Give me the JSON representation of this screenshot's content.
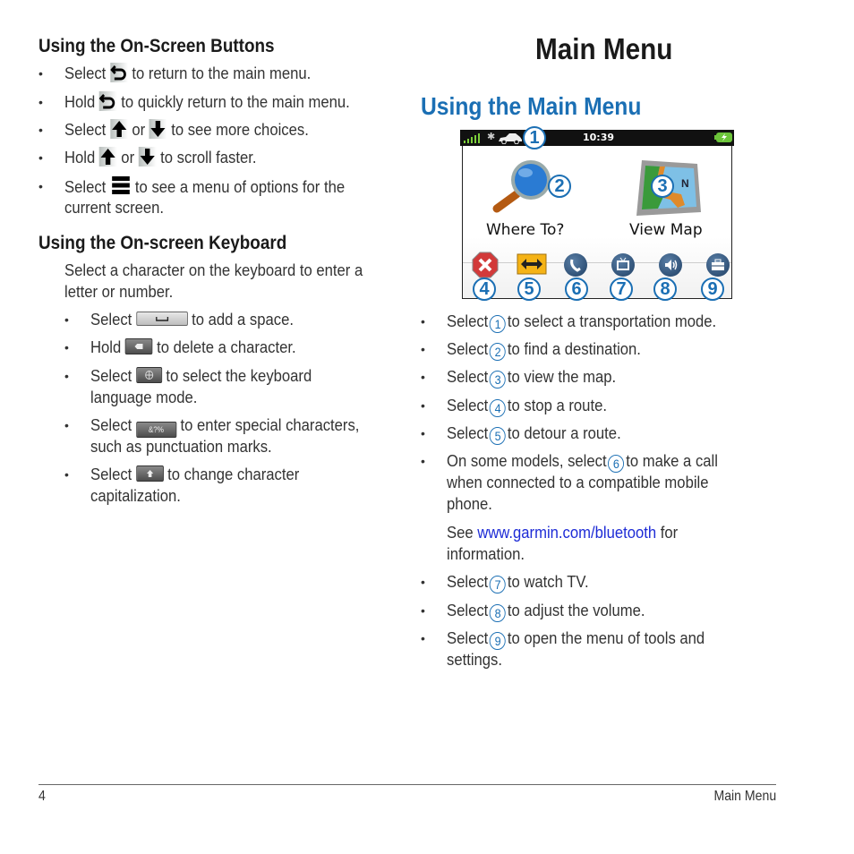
{
  "left": {
    "section1": {
      "title": "Using the On-Screen Buttons",
      "items": [
        {
          "prefix": "Select",
          "icon": "back-arrow-icon",
          "suffix": "to return to the main menu."
        },
        {
          "prefix": "Hold",
          "icon": "back-arrow-icon",
          "suffix": "to quickly return to the main menu."
        },
        {
          "prefix": "Select",
          "icon": "up-arrow-icon",
          "mid": "or",
          "icon2": "down-arrow-icon",
          "suffix": "to see more choices."
        },
        {
          "prefix": "Hold",
          "icon": "up-arrow-icon",
          "mid": "or",
          "icon2": "down-arrow-icon",
          "suffix": "to scroll faster."
        },
        {
          "prefix": "Select",
          "icon": "menu-icon",
          "suffix": "to see a menu of options for the",
          "line2": "current screen."
        }
      ]
    },
    "section2": {
      "title": "Using the On-screen Keyboard",
      "intro_line1": "Select a character on the keyboard to enter a",
      "intro_line2": "letter or number.",
      "items": [
        {
          "prefix": "Select",
          "icon": "space-key-icon",
          "suffix": "to add a space."
        },
        {
          "prefix": "Hold",
          "icon": "delete-key-icon",
          "suffix": "to delete a character."
        },
        {
          "prefix": "Select",
          "icon": "language-key-icon",
          "suffix": "to select the keyboard",
          "line2": "language mode."
        },
        {
          "prefix": "Select",
          "icon": "special-chars-key-icon",
          "key_label": "&?%",
          "suffix": "to enter special characters,",
          "line2": "such as punctuation marks."
        },
        {
          "prefix": "Select",
          "icon": "shift-key-icon",
          "suffix": "to change character",
          "line2": "capitalization."
        }
      ]
    }
  },
  "right": {
    "page_title": "Main Menu",
    "section_title": "Using the Main Menu",
    "device": {
      "time": "10:39",
      "where_to": "Where To?",
      "view_map": "View Map",
      "callouts": [
        "1",
        "2",
        "3",
        "4",
        "5",
        "6",
        "7",
        "8",
        "9"
      ]
    },
    "items": [
      {
        "prefix": "Select",
        "num": "1",
        "suffix": "to select a transportation mode."
      },
      {
        "prefix": "Select",
        "num": "2",
        "suffix": "to find a destination."
      },
      {
        "prefix": "Select",
        "num": "3",
        "suffix": "to view the map."
      },
      {
        "prefix": "Select",
        "num": "4",
        "suffix": "to stop a route."
      },
      {
        "prefix": "Select",
        "num": "5",
        "suffix": "to detour a route."
      },
      {
        "prefix": "On some models, select",
        "num": "6",
        "suffix": "to make a call",
        "line2": "when connected to a compatible mobile",
        "line3": "phone."
      },
      {
        "prefix": "Select",
        "num": "7",
        "suffix": "to watch TV."
      },
      {
        "prefix": "Select",
        "num": "8",
        "suffix": "to adjust the volume."
      },
      {
        "prefix": "Select",
        "num": "9",
        "suffix": "to open the menu of tools and",
        "line2": "settings."
      }
    ],
    "see_note": {
      "prefix": "See",
      "link": "www.garmin.com/bluetooth",
      "suffix": "for",
      "line2": "information."
    }
  },
  "footer": {
    "page_number": "4",
    "section": "Main Menu"
  },
  "colors": {
    "heading_blue": "#1b6fb4",
    "link_blue": "#1d2bd6",
    "text": "#333333"
  }
}
